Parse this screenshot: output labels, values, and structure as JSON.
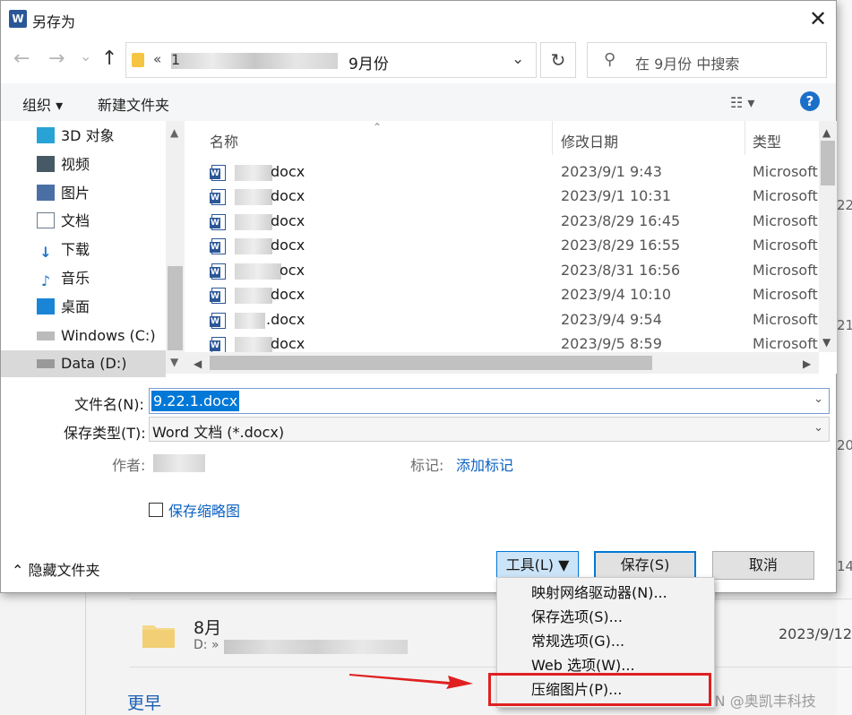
{
  "background": {
    "side_numbers": [
      "22",
      "21",
      "20",
      "14"
    ],
    "folder": {
      "name": "8月",
      "path_prefix": "D: »",
      "date": "2023/9/12"
    },
    "section_earlier": "更早",
    "watermark": "CSDN @奥凯丰科技"
  },
  "dialog": {
    "title": "另存为",
    "close_glyph": "✕",
    "nav": {
      "back": "←",
      "forward": "→",
      "recent": "⌄",
      "up": "↑"
    },
    "address": {
      "chevron": "«",
      "first_char": "1",
      "path_end": "9月份",
      "dropdown": "⌄"
    },
    "refresh": "↻",
    "search": {
      "icon": "⚲",
      "placeholder": "在 9月份 中搜索"
    },
    "toolbar": {
      "organize": "组织 ▾",
      "new_folder": "新建文件夹",
      "view": "☷ ▾",
      "help": "?"
    },
    "nav_items": [
      {
        "label": "3D 对象",
        "icon": "cube-3d-icon",
        "color": "#29a3d6"
      },
      {
        "label": "视频",
        "icon": "video-icon",
        "color": "#455a64"
      },
      {
        "label": "图片",
        "icon": "pictures-icon",
        "color": "#4a6fa5"
      },
      {
        "label": "文档",
        "icon": "documents-icon",
        "color": "#6b7b8c"
      },
      {
        "label": "下载",
        "icon": "download-icon",
        "color": "#1e73c9"
      },
      {
        "label": "音乐",
        "icon": "music-icon",
        "color": "#1e73c9"
      },
      {
        "label": "桌面",
        "icon": "desktop-icon",
        "color": "#1a85d6"
      },
      {
        "label": "Windows (C:)",
        "icon": "drive-c-icon",
        "color": "#888888"
      },
      {
        "label": "Data (D:)",
        "icon": "drive-d-icon",
        "color": "#888888"
      }
    ],
    "columns": {
      "name": "名称",
      "modified": "修改日期",
      "type": "类型"
    },
    "files": [
      {
        "name": "docx",
        "date": "2023/9/1 9:43",
        "type": "Microsoft"
      },
      {
        "name": "docx",
        "date": "2023/9/1 10:31",
        "type": "Microsoft"
      },
      {
        "name": "docx",
        "date": "2023/8/29 16:45",
        "type": "Microsoft"
      },
      {
        "name": "docx",
        "date": "2023/8/29 16:55",
        "type": "Microsoft"
      },
      {
        "name": "ocx",
        "date": "2023/8/31 16:56",
        "type": "Microsoft"
      },
      {
        "name": "docx",
        "date": "2023/9/4 10:10",
        "type": "Microsoft"
      },
      {
        "name": ".docx",
        "date": "2023/9/4 9:54",
        "type": "Microsoft"
      },
      {
        "name": "docx",
        "date": "2023/9/5 8:59",
        "type": "Microsoft"
      }
    ],
    "form": {
      "filename_label": "文件名(N):",
      "filename_value": "9.22.1.docx",
      "savetype_label": "保存类型(T):",
      "savetype_value": "Word 文档 (*.docx)",
      "author_label": "作者:",
      "tags_label": "标记:",
      "tags_link": "添加标记",
      "thumbnail_label": "保存缩略图"
    },
    "hide_folders": "⌃ 隐藏文件夹",
    "buttons": {
      "tools": "工具(L)  ▼",
      "save": "保存(S)",
      "cancel": "取消"
    },
    "tools_menu": [
      "映射网络驱动器(N)...",
      "保存选项(S)...",
      "常规选项(G)...",
      "Web 选项(W)...",
      "压缩图片(P)..."
    ]
  }
}
